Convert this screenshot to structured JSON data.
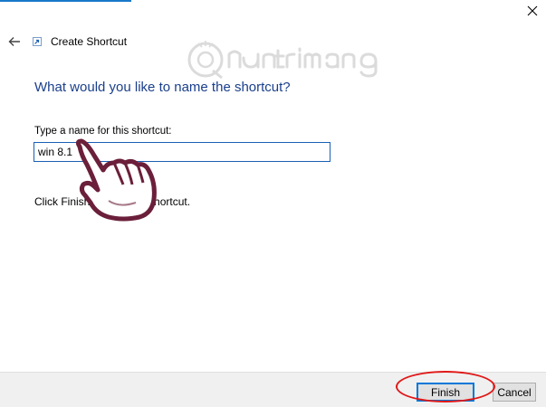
{
  "window": {
    "title": "Create Shortcut",
    "close_icon": "close-icon",
    "back_icon": "back-arrow-icon",
    "app_icon": "shortcut-icon"
  },
  "wizard": {
    "question": "What would you like to name the shortcut?",
    "name_label": "Type a name for this shortcut:",
    "name_value": "win 8.1",
    "hint_left": "Click Finish t",
    "hint_right": "shortcut."
  },
  "footer": {
    "finish_label": "Finish",
    "cancel_label": "Cancel"
  },
  "watermark": {
    "text": "Quantrimang"
  },
  "colors": {
    "accent": "#1979ca",
    "heading": "#1a3f8c",
    "highlight_ring": "#e01818",
    "hand_fill": "#6b1f3a"
  }
}
